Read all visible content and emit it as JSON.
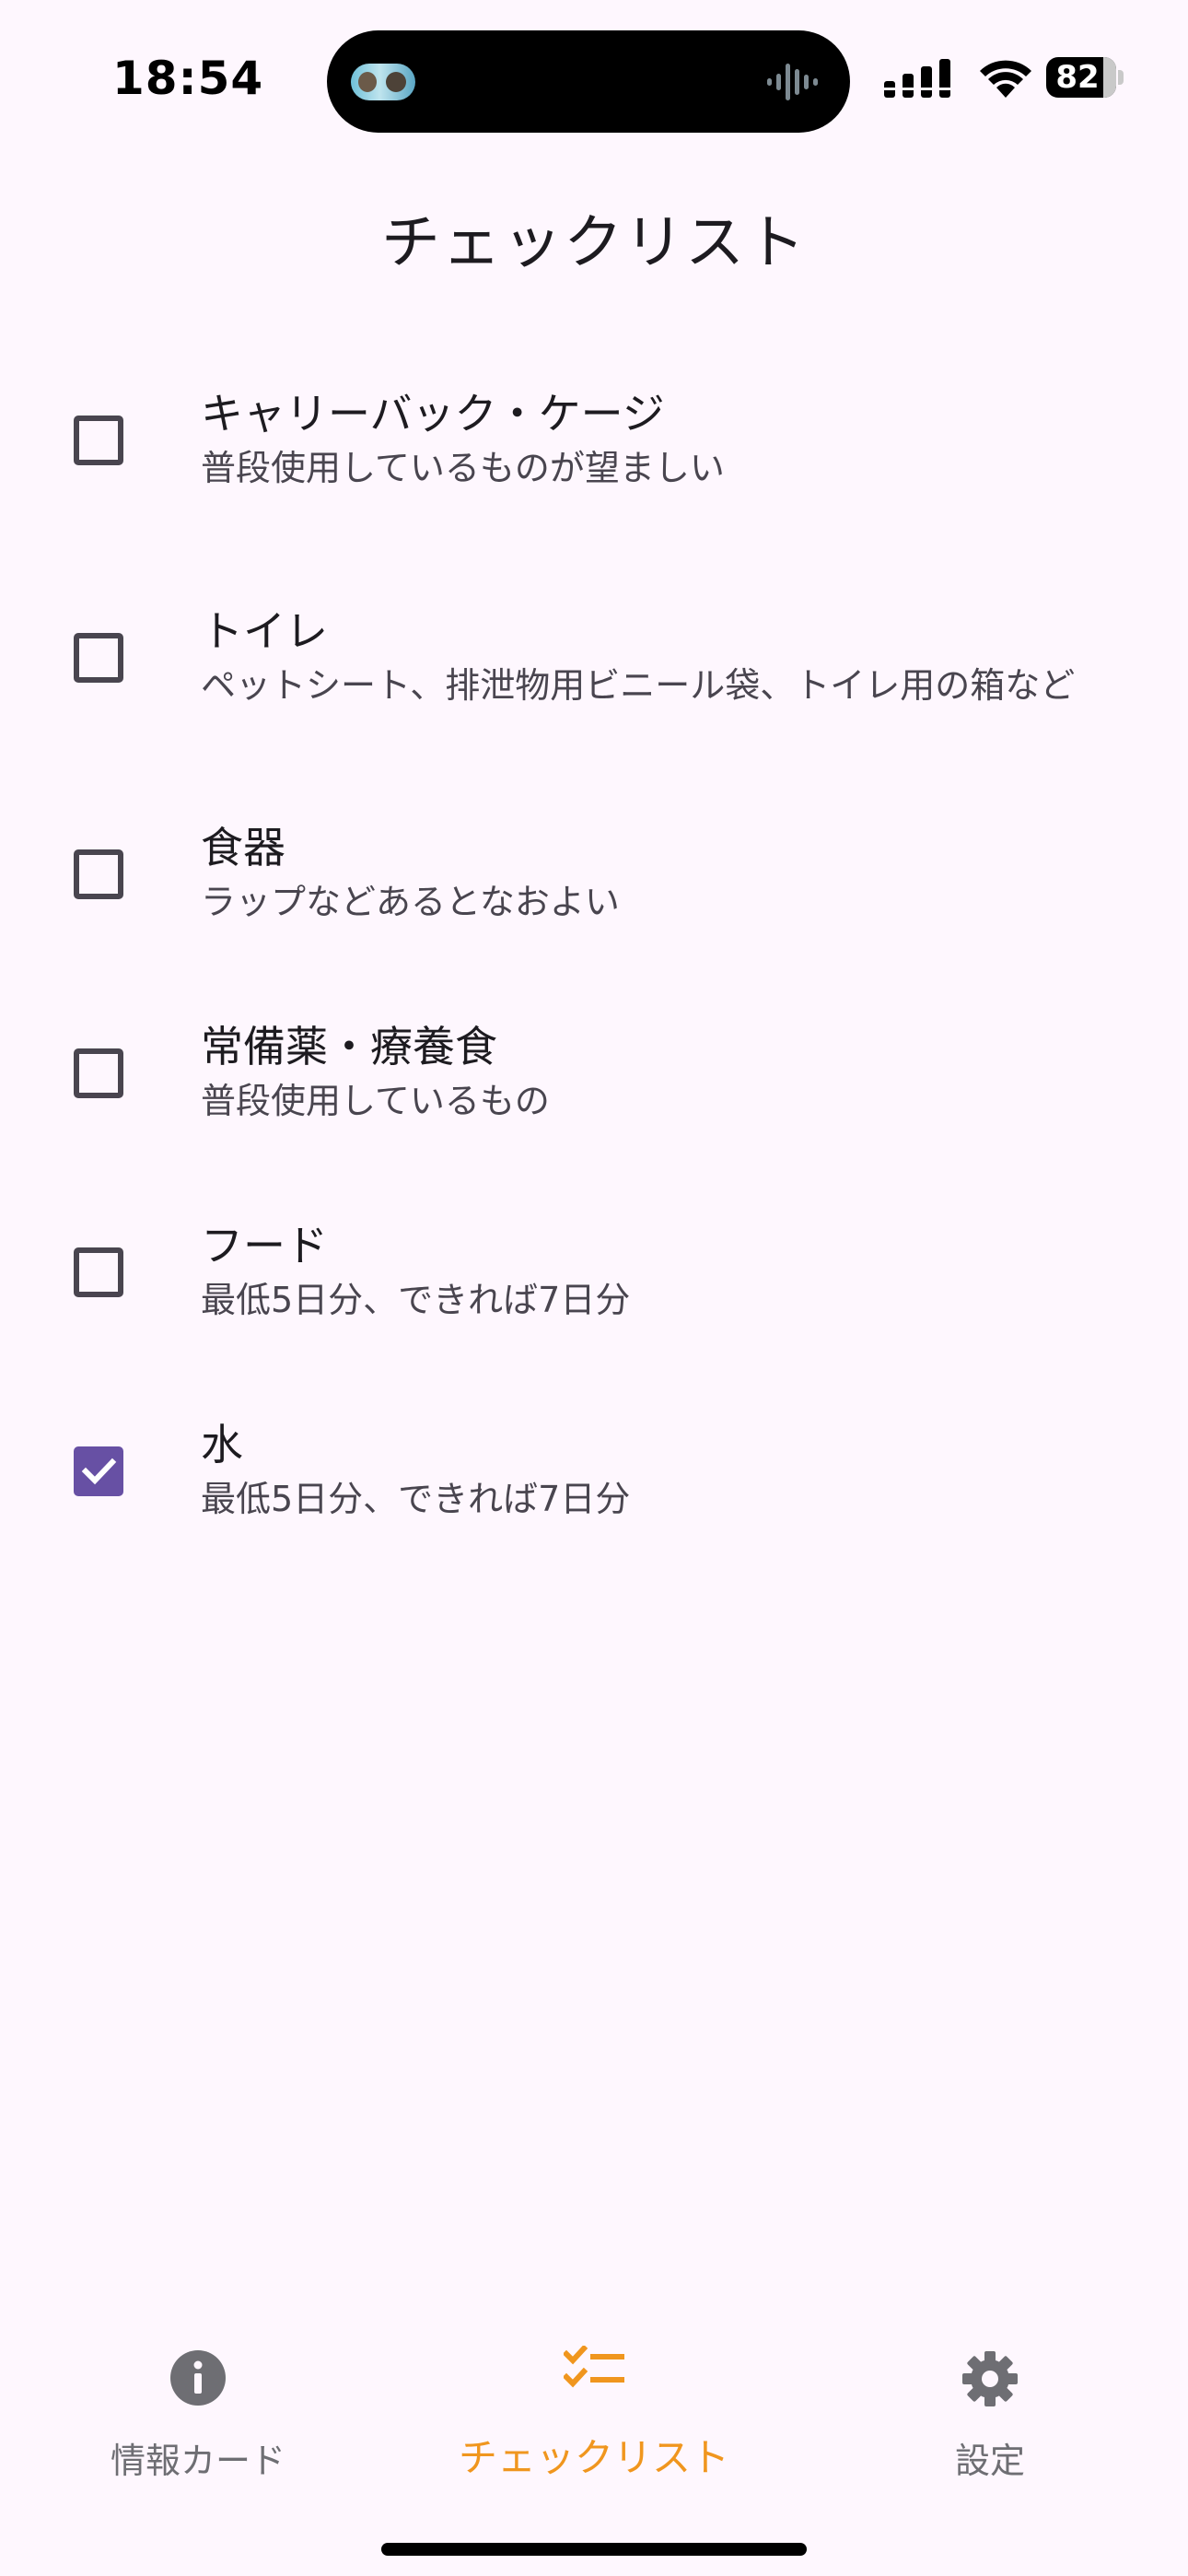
{
  "status_bar": {
    "time": "18:54",
    "battery_level": "82",
    "battery_fraction": 0.82
  },
  "header": {
    "title": "チェックリスト"
  },
  "checklist": {
    "items": [
      {
        "title": "キャリーバック・ケージ",
        "subtitle": "普段使用しているものが望ましい",
        "checked": false
      },
      {
        "title": "トイレ",
        "subtitle": "ペットシート、排泄物用ビニール袋、トイレ用の箱など",
        "checked": false
      },
      {
        "title": "食器",
        "subtitle": "ラップなどあるとなおよい",
        "checked": false
      },
      {
        "title": "常備薬・療養食",
        "subtitle": "普段使用しているもの",
        "checked": false
      },
      {
        "title": "フード",
        "subtitle": "最低5日分、できれば7日分",
        "checked": false
      },
      {
        "title": "水",
        "subtitle": "最低5日分、できれば7日分",
        "checked": true
      }
    ]
  },
  "bottom_nav": {
    "info": {
      "label": "情報カード",
      "icon": "info-icon"
    },
    "checklist": {
      "label": "チェックリスト",
      "icon": "checklist-icon",
      "active": true
    },
    "settings": {
      "label": "設定",
      "icon": "gear-icon"
    }
  },
  "colors": {
    "background": "#fef7fe",
    "checkbox_checked": "#6750a4",
    "nav_active": "#f0961e",
    "nav_inactive": "#6e6e73"
  }
}
